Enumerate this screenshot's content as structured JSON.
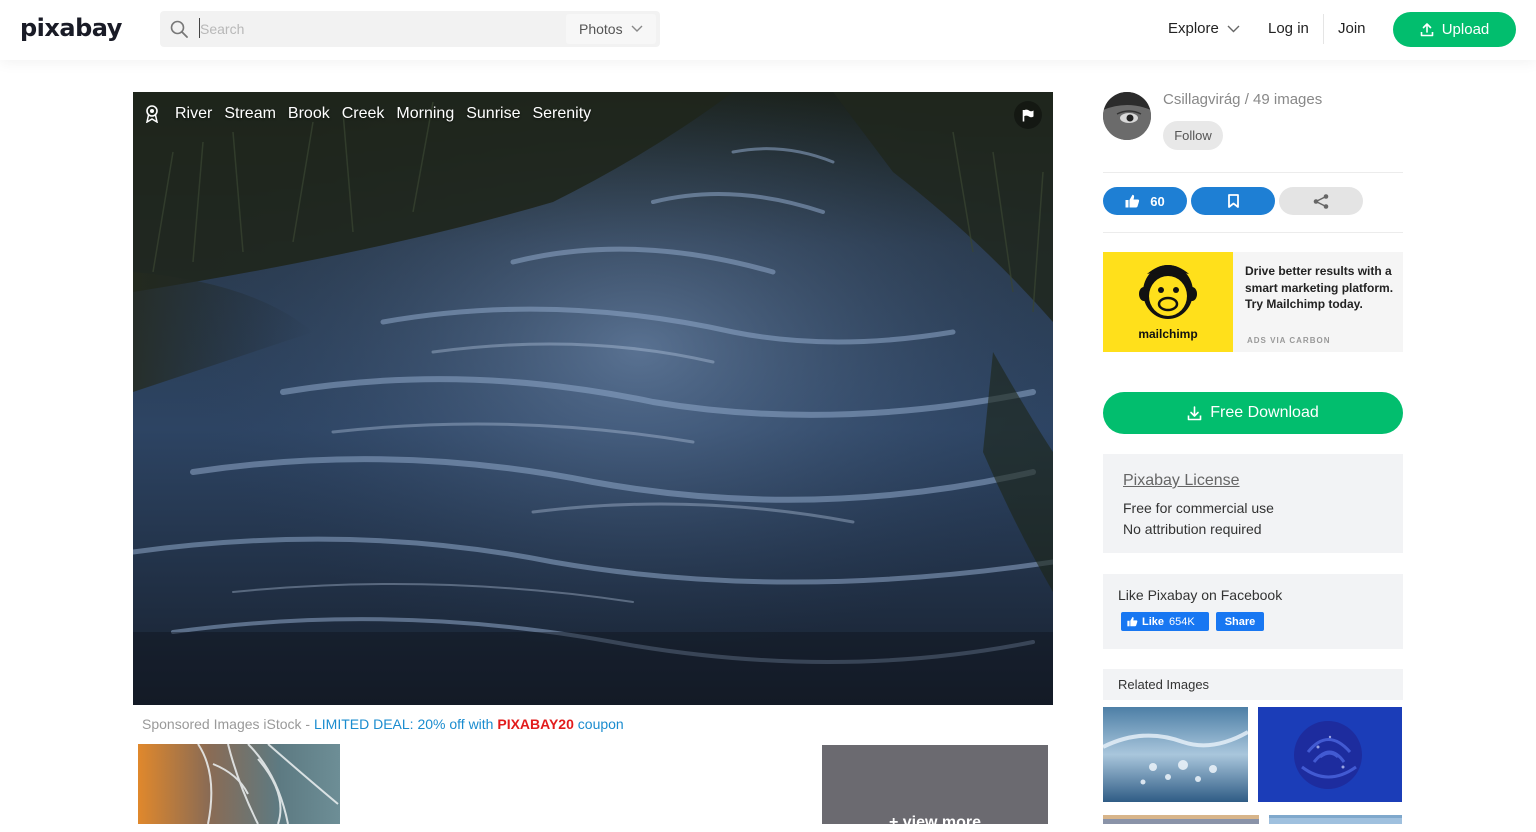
{
  "header": {
    "logo": "pixabay",
    "search_placeholder": "Search",
    "search_type": "Photos",
    "nav_explore": "Explore",
    "nav_login": "Log in",
    "nav_join": "Join",
    "upload_label": "Upload"
  },
  "photo": {
    "tags": [
      "River",
      "Stream",
      "Brook",
      "Creek",
      "Morning",
      "Sunrise",
      "Serenity"
    ]
  },
  "sponsored": {
    "prefix": "Sponsored Images iStock - ",
    "deal": "LIMITED DEAL: 20% off with ",
    "code": "PIXABAY20",
    "suffix": " coupon",
    "view_more": "+ view more"
  },
  "author": {
    "name_count": "Csillagvirág / 49 images",
    "follow_label": "Follow"
  },
  "actions": {
    "likes": "60"
  },
  "ad": {
    "brand": "mailchimp",
    "text": "Drive better results with a smart marketing platform. Try Mailchimp today.",
    "via": "ADS VIA CARBON"
  },
  "download": {
    "label": "Free Download"
  },
  "license": {
    "title": "Pixabay License",
    "line1": "Free for commercial use",
    "line2": "No attribution required"
  },
  "facebook": {
    "title": "Like Pixabay on Facebook",
    "like_label": "Like",
    "like_count": "654K",
    "share_label": "Share"
  },
  "related": {
    "title": "Related Images"
  },
  "colors": {
    "brand_green": "#02be6e",
    "action_blue": "#1e7fd4",
    "ad_yellow": "#ffe01b",
    "deal_blue": "#1a8ccf",
    "coupon_red": "#e21c1c"
  }
}
